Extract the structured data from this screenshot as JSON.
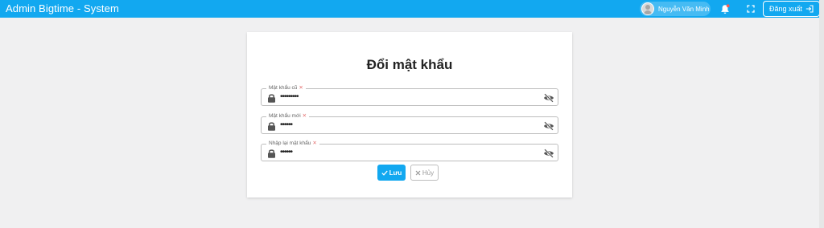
{
  "header": {
    "app_title": "Admin Bigtime - System",
    "user_name": "Nguyễn Văn Minh",
    "logout_label": "Đăng xuất",
    "accent_color": "#12a8f0"
  },
  "form": {
    "title": "Đổi mật khẩu",
    "required_mark": "✕",
    "fields": [
      {
        "label": "Mật khẩu cũ",
        "value": "•••••••••"
      },
      {
        "label": "Mật khẩu mới",
        "value": "••••••"
      },
      {
        "label": "Nhập lại mật khẩu",
        "value": "••••••"
      }
    ],
    "save_label": "Lưu",
    "cancel_label": "Hủy"
  },
  "icons": {
    "user": "avatar",
    "notification": "bell-icon",
    "fullscreen": "fullscreen-icon",
    "logout": "logout-icon",
    "field_lock": "lock-icon",
    "field_toggle": "eye-slash-icon",
    "save": "check-icon",
    "cancel": "close-icon"
  }
}
